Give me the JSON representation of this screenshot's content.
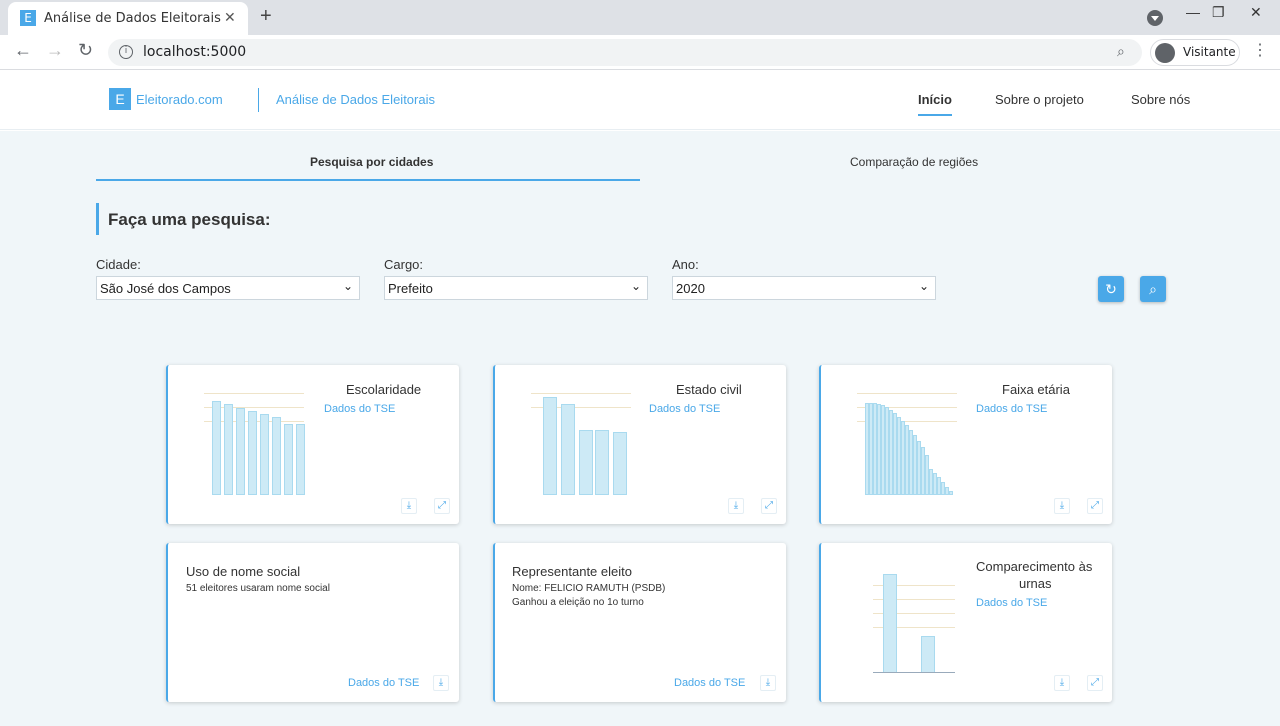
{
  "browser": {
    "tab_title": "Análise de Dados Eleitorais",
    "tab_favicon": "E",
    "url": "localhost:5000",
    "profile_label": "Visitante"
  },
  "header": {
    "logo_letter": "E",
    "logo_text": "Eleitorado.com",
    "subtitle": "Análise de Dados Eleitorais",
    "nav": [
      "Início",
      "Sobre o projeto",
      "Sobre nós"
    ]
  },
  "subtabs": [
    "Pesquisa por cidades",
    "Comparação de regiões"
  ],
  "search": {
    "title": "Faça uma pesquisa:",
    "city_label": "Cidade:",
    "city_value": "São José dos Campos",
    "role_label": "Cargo:",
    "role_value": "Prefeito",
    "year_label": "Ano:",
    "year_value": "2020"
  },
  "cards": {
    "escolaridade": {
      "title": "Escolaridade",
      "link": "Dados do TSE"
    },
    "estado_civil": {
      "title": "Estado civil",
      "link": "Dados do TSE"
    },
    "faixa_etaria": {
      "title": "Faixa etária",
      "link": "Dados do TSE"
    },
    "nome_social": {
      "title": "Uso de nome social",
      "text": "51 eleitores usaram nome social",
      "link": "Dados do TSE"
    },
    "eleito": {
      "title": "Representante eleito",
      "line1": "Nome: FELICIO RAMUTH (PSDB)",
      "line2": "Ganhou a eleição no 1o turno",
      "link": "Dados do TSE"
    },
    "comparecimento": {
      "title_line1": "Comparecimento às",
      "title_line2": "urnas",
      "link": "Dados do TSE"
    }
  },
  "colors": {
    "accent": "#4aa8e8",
    "background": "#f0f6f9"
  },
  "icons": [
    "download-icon",
    "expand-icon",
    "refresh-icon",
    "search-icon"
  ]
}
